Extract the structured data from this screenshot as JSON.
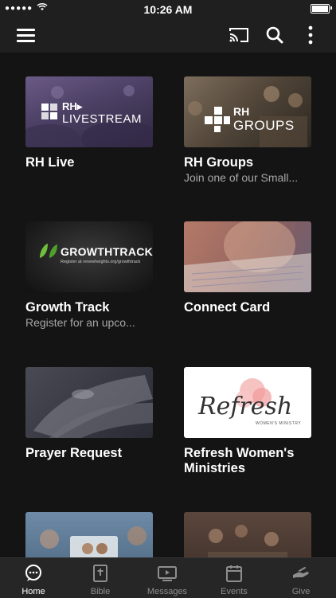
{
  "status_bar": {
    "time": "10:26 AM",
    "signal": "●●●●●"
  },
  "cards": [
    {
      "title": "RH Live",
      "subtitle": "",
      "thumb_line1": "RH▸",
      "thumb_line2": "LIVESTREAM"
    },
    {
      "title": "RH Groups",
      "subtitle": "Join one of our Small...",
      "thumb_line1": "RH",
      "thumb_line2": "GROUPS"
    },
    {
      "title": "Growth Track",
      "subtitle": "Register for an upco...",
      "thumb_line1": "GROWTHTRACK",
      "thumb_line2": "Register at renewheights.org/growthtrack"
    },
    {
      "title": "Connect Card",
      "subtitle": ""
    },
    {
      "title": "Prayer Request",
      "subtitle": ""
    },
    {
      "title": "Refresh Women's Ministries",
      "subtitle": "",
      "thumb_line1": "Refresh",
      "thumb_line2": "WOMEN'S MINISTRY"
    },
    {
      "title": "",
      "subtitle": ""
    },
    {
      "title": "",
      "subtitle": ""
    }
  ],
  "tabs": [
    {
      "label": "Home",
      "icon": "chat-bubble-icon",
      "active": true
    },
    {
      "label": "Bible",
      "icon": "bible-icon",
      "active": false
    },
    {
      "label": "Messages",
      "icon": "video-icon",
      "active": false
    },
    {
      "label": "Events",
      "icon": "calendar-icon",
      "active": false
    },
    {
      "label": "Give",
      "icon": "give-hand-icon",
      "active": false
    }
  ],
  "colors": {
    "background": "#141414",
    "toolbar": "#1f1f1f",
    "tabbar": "#262626",
    "subtitle": "#a7a7a7"
  }
}
